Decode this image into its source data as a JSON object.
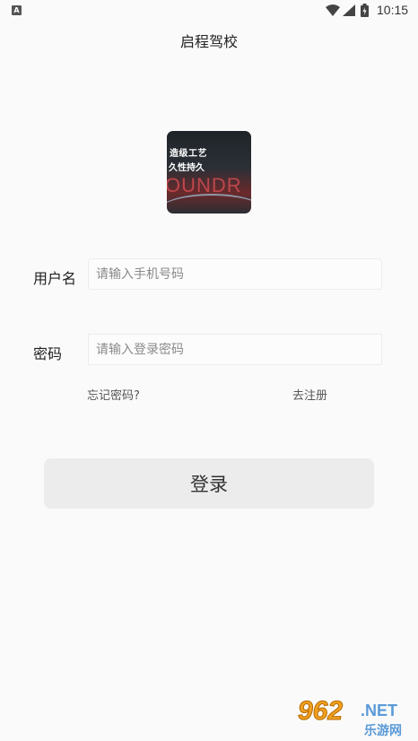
{
  "status_bar": {
    "app_icon_letter": "A",
    "time": "10:15"
  },
  "header": {
    "title": "启程驾校"
  },
  "logo": {
    "line1": "造级工艺",
    "line2": "久性持久",
    "big_text": "OUNDR"
  },
  "form": {
    "username_label": "用户名",
    "username_placeholder": "请输入手机号码",
    "username_value": "",
    "password_label": "密码",
    "password_placeholder": "请输入登录密码",
    "password_value": "",
    "forgot_password": "忘记密码?",
    "register": "去注册",
    "login_button": "登录"
  },
  "watermark": {
    "number": "962",
    "domain": ".NET",
    "site_name": "乐游网"
  },
  "colors": {
    "background": "#fafafa",
    "button_bg": "#ececec",
    "input_border": "#ececec",
    "watermark_orange": "#f0a020",
    "watermark_blue": "#5a9ad8"
  }
}
